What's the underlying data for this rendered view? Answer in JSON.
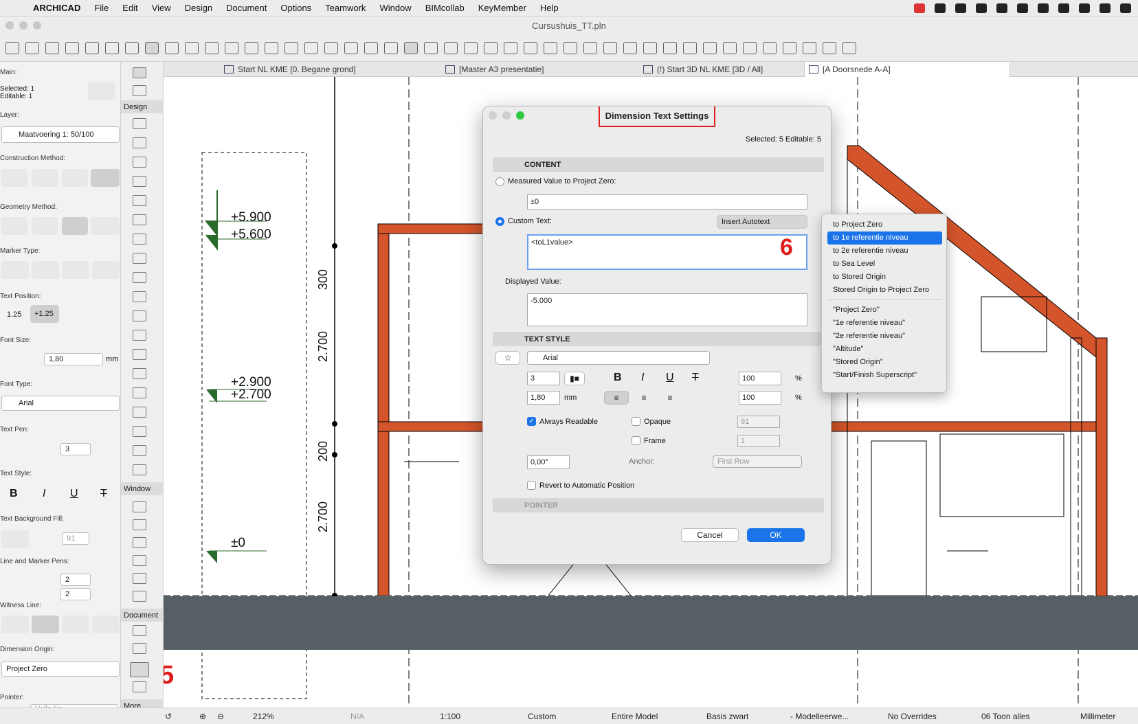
{
  "menubar": {
    "items": [
      "ARCHICAD",
      "File",
      "Edit",
      "View",
      "Design",
      "Document",
      "Options",
      "Teamwork",
      "Window",
      "BIMcollab",
      "KeyMember",
      "Help"
    ]
  },
  "window": {
    "title": "Cursushuis_TT.pln"
  },
  "tabs": [
    {
      "label": "Start NL KME [0. Begane grond]"
    },
    {
      "label": "[Master A3 presentatie]"
    },
    {
      "label": "(!) Start 3D NL KME [3D / All]"
    },
    {
      "label": "[A Doorsnede A-A]"
    }
  ],
  "info_box": {
    "main_label": "Main:",
    "selected": "Selected: 1",
    "editable": "Editable: 1",
    "layer_label": "Layer:",
    "layer_value": "Maatvoering 1: 50/100",
    "construction_label": "Construction Method:",
    "geometry_label": "Geometry Method:",
    "marker_label": "Marker Type:",
    "text_position_label": "Text Position:",
    "text_position_opts": [
      "1.25",
      "+1.25"
    ],
    "font_size_label": "Font Size:",
    "font_size_value": "1,80",
    "font_size_unit": "mm",
    "font_type_label": "Font Type:",
    "font_type_value": "Arial",
    "text_pen_label": "Text Pen:",
    "text_pen_value": "3",
    "text_style_label": "Text Style:",
    "text_bg_label": "Text Background Fill:",
    "text_bg_value": "91",
    "line_marker_label": "Line and Marker Pens:",
    "line_pen": "2",
    "marker_pen": "2",
    "witness_label": "Witness Line:",
    "dim_origin_label": "Dimension Origin:",
    "dim_origin_value": "Project Zero",
    "pointer_label": "Pointer:",
    "pointer_value": "Volle lijn"
  },
  "toolbox": {
    "sections": [
      "Design",
      "Window",
      "Document",
      "More"
    ]
  },
  "canvas": {
    "levels": [
      "+5.900",
      "+5.600",
      "+2.900",
      "+2.700",
      "±0"
    ],
    "dims": [
      "300",
      "2.700",
      "200",
      "2.700"
    ],
    "step5": "5",
    "step6": "6"
  },
  "dialog": {
    "title": "Dimension Text Settings",
    "selected": "Selected: 5 Editable: 5",
    "content_header": "CONTENT",
    "measured_label": "Measured Value to Project Zero:",
    "measured_value": "±0",
    "custom_label": "Custom Text:",
    "insert_autotext": "Insert Autotext",
    "custom_value": "<toL1value>",
    "displayed_label": "Displayed Value:",
    "displayed_value": "-5.000",
    "text_style_header": "TEXT STYLE",
    "font_value": "Arial",
    "pen_value": "3",
    "size_value": "1,80",
    "size_unit": "mm",
    "width_pct": "100",
    "spacing_pct": "100",
    "pct": "%",
    "always_readable": "Always Readable",
    "opaque": "Opaque",
    "opaque_pen": "91",
    "frame": "Frame",
    "frame_pen": "1",
    "angle": "0,00°",
    "anchor_label": "Anchor:",
    "anchor_value": "First Row",
    "revert": "Revert to Automatic Position",
    "pointer_header": "POINTER",
    "cancel": "Cancel",
    "ok": "OK"
  },
  "autotext_menu": {
    "group1": [
      "to Project Zero",
      "to 1e referentie niveau",
      "to 2e referentie niveau",
      "to Sea Level",
      "to Stored Origin",
      "Stored Origin to Project Zero"
    ],
    "group2": [
      "\"Project Zero\"",
      "\"1e referentie niveau\"",
      "\"2e referentie niveau\"",
      "\"Altitude\"",
      "\"Stored Origin\"",
      "\"Start/Finish Superscript\""
    ],
    "highlighted": "to 1e referentie niveau"
  },
  "statusbar": {
    "zoom": "212%",
    "na": "N/A",
    "scale": "1:100",
    "custom": "Custom",
    "model": "Entire Model",
    "pen_set": "Basis zwart",
    "view": "- Modelleerwe...",
    "overrides": "No Overrides",
    "layer_combo": "06 Toon alles",
    "unit": "Millimeter"
  },
  "colors": {
    "accent": "#1a73e8",
    "wall": "#d4552b",
    "highlight_red": "#e02020",
    "ground": "#555f64"
  }
}
